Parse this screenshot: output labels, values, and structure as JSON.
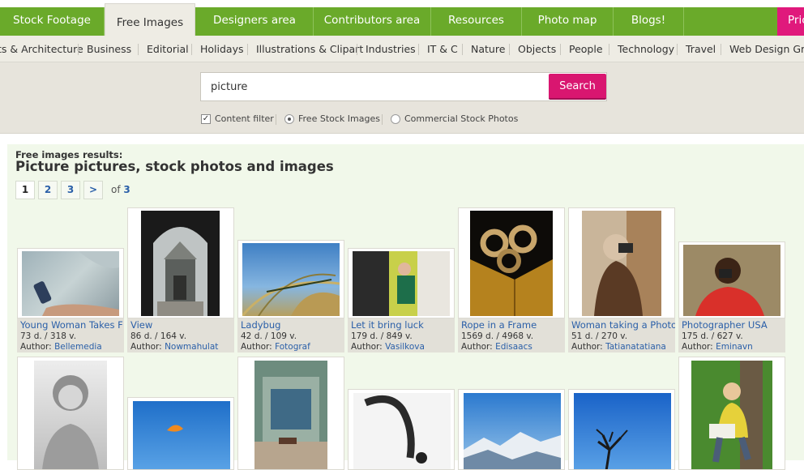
{
  "nav": {
    "tabs": [
      {
        "label": "Stock Footage"
      },
      {
        "label": "Free Images"
      },
      {
        "label": "Designers area"
      },
      {
        "label": "Contributors area"
      },
      {
        "label": "Resources"
      },
      {
        "label": "Photo map"
      },
      {
        "label": "Blogs!"
      },
      {
        "label": "Pric"
      }
    ],
    "active_tab": "Free Images"
  },
  "categories": [
    "ts & Architecture",
    "Business",
    "Editorial",
    "Holidays",
    "Illustrations & Clipart",
    "Industries",
    "IT & C",
    "Nature",
    "Objects",
    "People",
    "Technology",
    "Travel",
    "Web Design Gra"
  ],
  "search": {
    "value": "picture",
    "button": "Search",
    "filters": {
      "content_filter": {
        "label": "Content filter",
        "checked": true
      },
      "free_stock": {
        "label": "Free Stock Images",
        "selected": true
      },
      "commercial": {
        "label": "Commercial Stock Photos",
        "selected": false
      }
    }
  },
  "results": {
    "label": "Free images results:",
    "title": "Picture pictures, stock photos and images",
    "pager": {
      "pages": [
        "1",
        "2",
        "3",
        ">"
      ],
      "current": "1",
      "of_text": "of",
      "total": "3"
    },
    "row1": [
      {
        "title": "Young Woman Takes F",
        "stats": "73 d. / 318 v.",
        "author_label": "Author:",
        "author": "Bellemedia"
      },
      {
        "title": "View",
        "stats": "86 d. / 164 v.",
        "author_label": "Author:",
        "author": "Nowmahulat"
      },
      {
        "title": "Ladybug",
        "stats": "42 d. / 109 v.",
        "author_label": "Author:",
        "author": "Fotograf"
      },
      {
        "title": "Let it bring luck",
        "stats": "179 d. / 849 v.",
        "author_label": "Author:",
        "author": "Vasilkova"
      },
      {
        "title": "Rope in a Frame",
        "stats": "1569 d. / 4968 v.",
        "author_label": "Author:",
        "author": "Edisaacs"
      },
      {
        "title": "Woman taking a Photo",
        "stats": "51 d. / 270 v.",
        "author_label": "Author:",
        "author": "Tatianatatiana"
      },
      {
        "title": "Photographer USA",
        "stats": "175 d. / 627 v.",
        "author_label": "Author:",
        "author": "Eminavn"
      }
    ]
  }
}
